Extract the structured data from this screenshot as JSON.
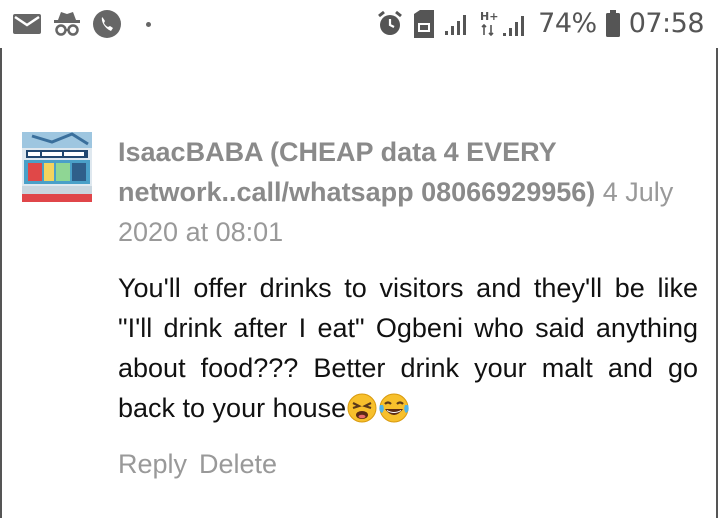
{
  "status_bar": {
    "left_icons": [
      "mail-icon",
      "incognito-icon",
      "phone-icon",
      "notification-dot"
    ],
    "right_icons": [
      "alarm-icon",
      "sim-icon",
      "signal-icon",
      "hplus-signal-icon",
      "battery-icon"
    ],
    "network_type": "H+",
    "battery_percent": "74%",
    "time": "07:58"
  },
  "comment": {
    "author": "IsaacBABA (CHEAP data 4 EVERY network..call/whatsapp 08066929956)",
    "date": "4 July 2020 at 08:01",
    "body": "You'll offer drinks to visitors and they'll be like \"I'll drink after I eat\" Ogbeni who said anything about food??? Better drink your malt and go back to your house",
    "emojis": [
      "tired-face-emoji",
      "laughing-tears-emoji"
    ],
    "reply_label": "Reply",
    "delete_label": "Delete"
  },
  "colors": {
    "muted_text": "#999999",
    "body_text": "#111111",
    "status_icon": "#555555"
  }
}
